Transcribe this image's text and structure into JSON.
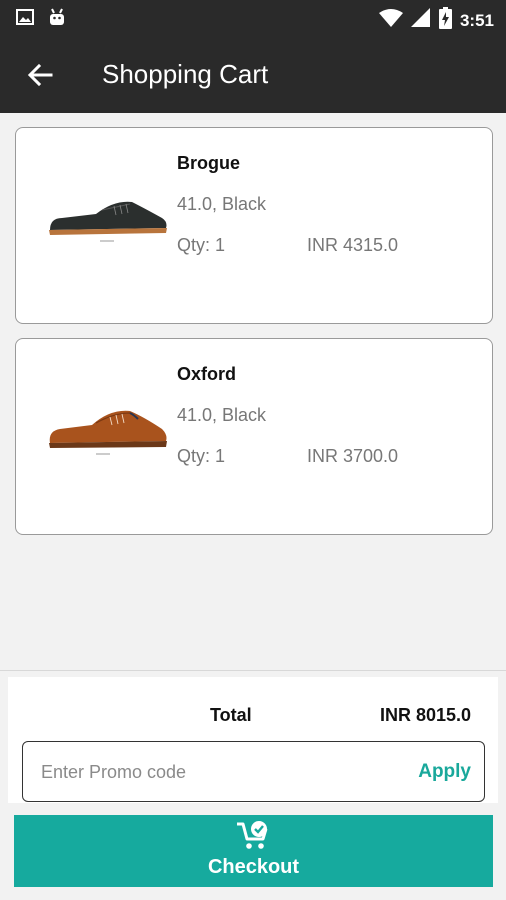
{
  "status_bar": {
    "time": "3:51"
  },
  "app_bar": {
    "title": "Shopping Cart"
  },
  "cart": {
    "items": [
      {
        "name": "Brogue",
        "variant": "41.0, Black",
        "qty": "Qty: 1",
        "price": "INR 4315.0"
      },
      {
        "name": "Oxford",
        "variant": "41.0, Black",
        "qty": "Qty: 1",
        "price": "INR 3700.0"
      }
    ],
    "total_label": "Total",
    "total_value": "INR 8015.0"
  },
  "promo": {
    "placeholder": "Enter Promo code",
    "value": "",
    "apply_label": "Apply"
  },
  "checkout": {
    "label": "Checkout"
  },
  "colors": {
    "app_bar": "#2a2a2a",
    "accent": "#16aa9e",
    "background": "#f2f2f2"
  }
}
